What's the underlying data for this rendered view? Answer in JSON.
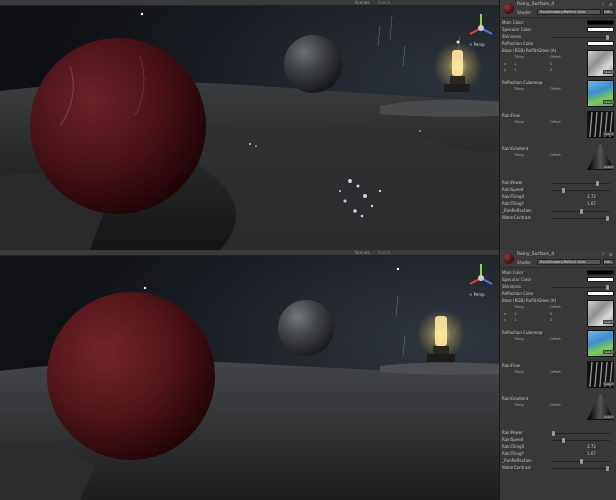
{
  "scene_view": {
    "tab_label": "Scenes",
    "tab_extra": "Scene",
    "persp_label": "< Persp",
    "gizmo_icon": "scene-gizmo-icon"
  },
  "inspector": {
    "material_name": "Rainy_Surface_4",
    "shader_label": "Shader",
    "shader_value": "RainShaders/Reflect Spec",
    "edit_label": "Edit...",
    "props": {
      "main_color": "Main Color",
      "specular_color": "Specular Color",
      "shininess": "Shininess",
      "reflection_color": "Reflection Color",
      "base_tex": "Base (RGB) RefStrGloss (A)",
      "tiling": "Tiling",
      "offset": "Offset",
      "x": "x",
      "y": "y",
      "tex_x_tiling": "1",
      "tex_x_offset": "0",
      "tex_y_tiling": "1",
      "tex_y_offset": "0",
      "select": "Select",
      "reflection_cubemap": "Reflection Cubemap",
      "rainflow": "RainFlow",
      "rain_gradient": "RainGradient",
      "rain_power": "RainPower",
      "rain_speed": "RainSpeed",
      "rain_tiling_x": "RainTilingX",
      "rain_tiling_y": "RainTilingY",
      "rim_reflection": "_RimReflection",
      "water_contrast": "WaterContrast",
      "rain_tiling_x_val": "3.72",
      "rain_tiling_y_val": "1.67"
    },
    "colors": {
      "main": "#000000",
      "specular": "#ffffff",
      "reflection": "#ffffff"
    }
  }
}
